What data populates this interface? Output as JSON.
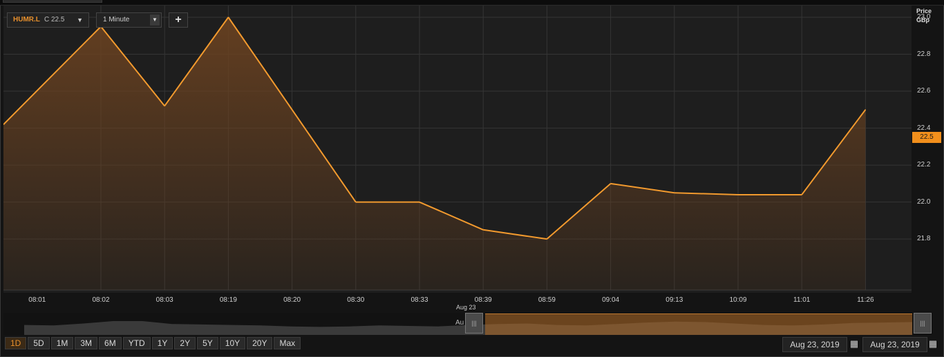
{
  "instrument": {
    "symbol": "HUMR.L",
    "close_label": "C 22.5",
    "dropdown_glyph": "▼"
  },
  "interval": {
    "value": "1 Minute",
    "dropdown_glyph": "▼"
  },
  "add_label": "+",
  "yaxis": {
    "title_line1": "Price",
    "title_line2": "GBp"
  },
  "last_price": "22.5",
  "colors": {
    "line": "#f29a2e",
    "area": "#6b4220",
    "price_tag": "#f28f1c",
    "grid": "#353535",
    "plot_bg": "#1e1e1e"
  },
  "chart_data": {
    "type": "area",
    "categories": [
      "08:01",
      "08:02",
      "08:03",
      "08:19",
      "08:20",
      "08:30",
      "08:33",
      "08:39",
      "08:59",
      "09:04",
      "09:13",
      "10:09",
      "11:01",
      "11:26"
    ],
    "series": [
      {
        "values": [
          22.42,
          22.95,
          22.52,
          23.0,
          22.5,
          22.0,
          22.0,
          21.85,
          21.8,
          22.1,
          22.05,
          22.04,
          22.04,
          22.5
        ]
      }
    ],
    "first_point": 22.42,
    "yticks": [
      21.8,
      22.0,
      22.2,
      22.4,
      22.6,
      22.8,
      23.0
    ],
    "ylim": [
      21.75,
      23.1
    ],
    "grid": true,
    "ylabel": "Price GBp",
    "xlabel": ""
  },
  "navigator": {
    "date_top": "Aug 23",
    "date_clip": "Au",
    "handle_glyph": "|||",
    "profile": [
      0.6,
      0.55,
      0.75,
      1.0,
      1.0,
      0.7,
      0.65,
      0.6,
      0.55,
      0.45,
      0.4,
      0.45,
      0.55,
      0.5,
      0.45,
      0.6,
      0.7,
      0.75,
      0.6,
      0.55,
      0.7,
      0.85,
      0.95,
      0.9,
      0.75,
      0.6,
      0.55,
      0.65,
      0.8,
      0.85,
      0.9
    ]
  },
  "ranges": [
    "1D",
    "5D",
    "1M",
    "3M",
    "6M",
    "YTD",
    "1Y",
    "2Y",
    "5Y",
    "10Y",
    "20Y",
    "Max"
  ],
  "active_range": "1D",
  "date_from": "Aug 23, 2019",
  "date_to": "Aug 23, 2019",
  "calendar_glyph": "▦"
}
